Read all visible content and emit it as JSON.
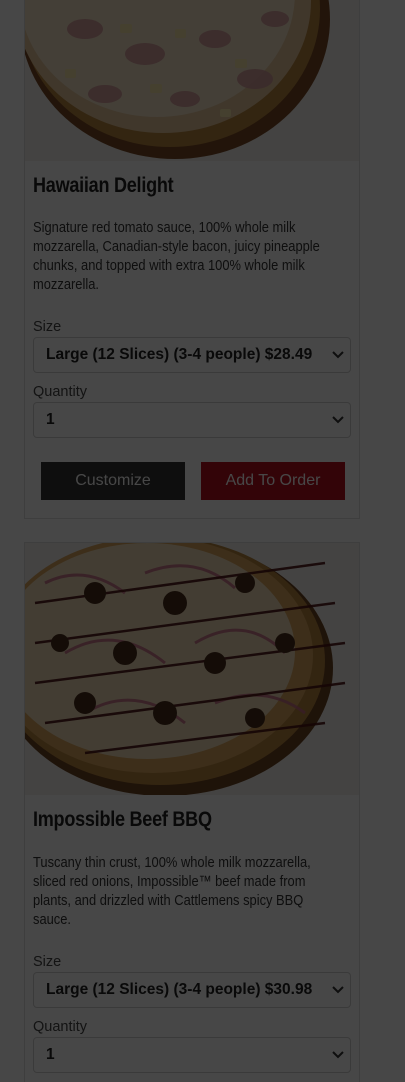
{
  "products": [
    {
      "name": "Hawaiian Delight",
      "description": "Signature red tomato sauce, 100% whole milk mozzarella, Canadian-style bacon, juicy pineapple chunks, and topped with extra 100% whole milk mozzarella.",
      "size_label": "Size",
      "size_value": "Large (12 Slices) (3-4 people) $28.49",
      "quantity_label": "Quantity",
      "quantity_value": "1",
      "customize_label": "Customize",
      "add_label": "Add To Order"
    },
    {
      "name": "Impossible Beef BBQ",
      "description": "Tuscany thin crust, 100% whole milk mozzarella, sliced red onions, Impossible™ beef made from plants, and drizzled with Cattlemens spicy BBQ sauce.",
      "size_label": "Size",
      "size_value": "Large (12 Slices) (3-4 people) $30.98",
      "quantity_label": "Quantity",
      "quantity_value": "1"
    }
  ],
  "colors": {
    "overlay": "#000000",
    "add_button": "#b8111d",
    "customize_button": "#333333"
  },
  "icons": {
    "select_arrow": "chevron-down-icon"
  }
}
